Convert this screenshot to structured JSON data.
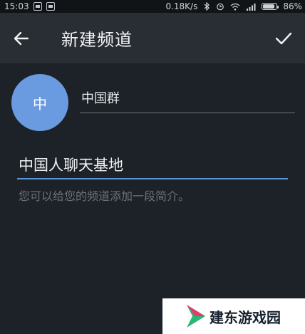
{
  "status_bar": {
    "time": "15:03",
    "net_speed": "0.18K/s",
    "battery": "86%",
    "battery_level": 0.86
  },
  "appbar": {
    "title": "新建频道"
  },
  "avatar": {
    "initial": "中",
    "color": "#6a9be0"
  },
  "name_field": {
    "value": "中国群"
  },
  "description_field": {
    "value": "中国人聊天基地",
    "hint": "您可以给您的频道添加一段简介。"
  },
  "watermark": {
    "text": "建东游戏园"
  },
  "icons": [
    "back-arrow-icon",
    "check-icon",
    "bluetooth-icon",
    "wifi-icon",
    "signal-icon",
    "battery-icon"
  ],
  "colors": {
    "background": "#1d2228",
    "appbar": "#292e34",
    "accent": "#5a94d6"
  }
}
